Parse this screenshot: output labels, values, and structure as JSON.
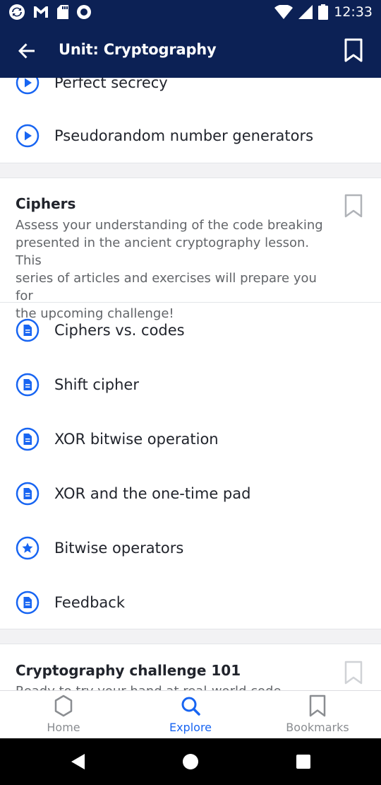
{
  "status_bar": {
    "time": "12:33",
    "left_icons": [
      "sync-icon",
      "gmail-icon",
      "sd-card-icon",
      "circle-icon"
    ],
    "right_icons": [
      "wifi-icon",
      "signal-icon",
      "battery-icon"
    ]
  },
  "app_bar": {
    "title": "Unit: Cryptography",
    "back_icon": "arrow-left-icon",
    "bookmark_icon": "bookmark-outline-icon"
  },
  "top_items": [
    {
      "label": "Perfect secrecy",
      "icon": "video-play-icon"
    },
    {
      "label": "Pseudorandom number generators",
      "icon": "video-play-icon"
    }
  ],
  "ciphers_section": {
    "title": "Ciphers",
    "description_lines": [
      "Assess your understanding of the code breaking",
      "presented in the ancient cryptography lesson. This",
      "series of articles and exercises will prepare you for",
      "the upcoming challenge!"
    ],
    "items": [
      {
        "label": "Ciphers vs. codes",
        "icon": "article-icon"
      },
      {
        "label": "Shift cipher",
        "icon": "article-icon"
      },
      {
        "label": "XOR bitwise operation",
        "icon": "article-icon"
      },
      {
        "label": "XOR and the one-time pad",
        "icon": "article-icon"
      },
      {
        "label": "Bitwise operators",
        "icon": "exercise-star-icon"
      },
      {
        "label": "Feedback",
        "icon": "article-icon"
      }
    ]
  },
  "challenge_section": {
    "title": "Cryptography challenge 101",
    "description_partial": "Ready to try your hand at real-world code"
  },
  "bottom_nav": {
    "items": [
      {
        "label": "Home",
        "icon": "home-hexagon-icon",
        "active": false
      },
      {
        "label": "Explore",
        "icon": "search-icon",
        "active": true
      },
      {
        "label": "Bookmarks",
        "icon": "bookmark-icon",
        "active": false
      }
    ]
  },
  "colors": {
    "header_bg": "#0c2155",
    "accent": "#1865f2",
    "text_primary": "#21242c",
    "text_secondary": "#626569",
    "inactive": "#8a8d91"
  }
}
